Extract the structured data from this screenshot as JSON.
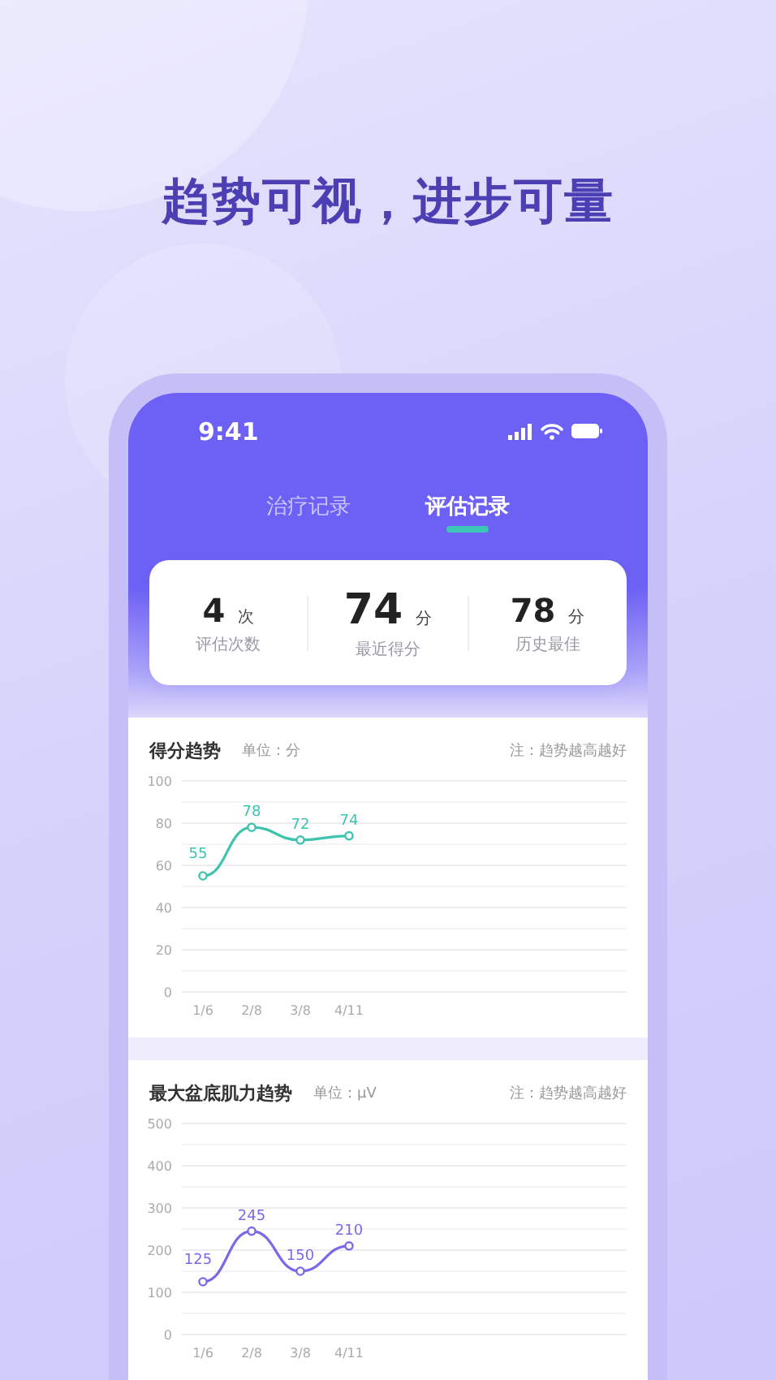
{
  "headline": "趋势可视，进步可量",
  "status_bar": {
    "time": "9:41"
  },
  "tabs": [
    {
      "label": "治疗记录",
      "selected": false
    },
    {
      "label": "评估记录",
      "selected": true
    }
  ],
  "stats": [
    {
      "value": "4",
      "unit": "次",
      "label": "评估次数",
      "emphasis": false
    },
    {
      "value": "74",
      "unit": "分",
      "label": "最近得分",
      "emphasis": true
    },
    {
      "value": "78",
      "unit": "分",
      "label": "历史最佳",
      "emphasis": false
    }
  ],
  "charts": [
    {
      "title": "得分趋势",
      "unit_label": "单位：分",
      "note": "注：趋势越高越好",
      "chart_data": {
        "type": "line",
        "categories": [
          "1/6",
          "2/8",
          "3/8",
          "4/11"
        ],
        "series": [
          {
            "color": "#3ec3ae",
            "marker": "circle",
            "values": [
              55,
              78,
              72,
              74
            ]
          }
        ],
        "grid": true,
        "ylim": [
          0,
          100
        ],
        "yticks": [
          0,
          20,
          40,
          60,
          80,
          100
        ],
        "data_labels": true
      }
    },
    {
      "title": "最大盆底肌力趋势",
      "unit_label": "单位：μV",
      "note": "注：趋势越高越好",
      "chart_data": {
        "type": "line",
        "categories": [
          "1/6",
          "2/8",
          "3/8",
          "4/11"
        ],
        "series": [
          {
            "color": "#7a6ae6",
            "marker": "circle",
            "values": [
              125,
              245,
              150,
              210
            ]
          }
        ],
        "grid": true,
        "ylim": [
          0,
          500
        ],
        "yticks": [
          0,
          100,
          200,
          300,
          400,
          500
        ],
        "data_labels": true
      }
    }
  ]
}
